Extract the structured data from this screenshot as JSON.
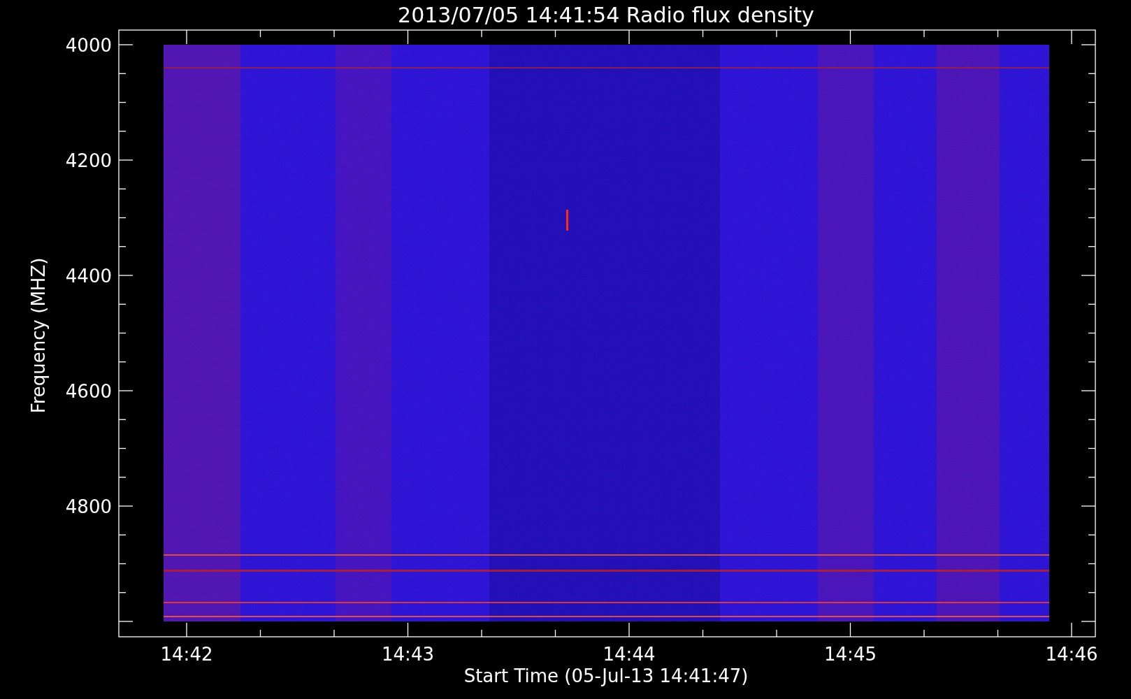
{
  "title": "2013/07/05 14:41:54 Radio flux density",
  "y_axis": {
    "label": "Frequency (MHZ)",
    "ticks": [
      "4000",
      "4200",
      "4400",
      "4600",
      "4800"
    ]
  },
  "x_axis": {
    "label": "Start Time (05-Jul-13 14:41:47)",
    "ticks": [
      "14:42",
      "14:43",
      "14:44",
      "14:45",
      "14:46"
    ]
  }
}
